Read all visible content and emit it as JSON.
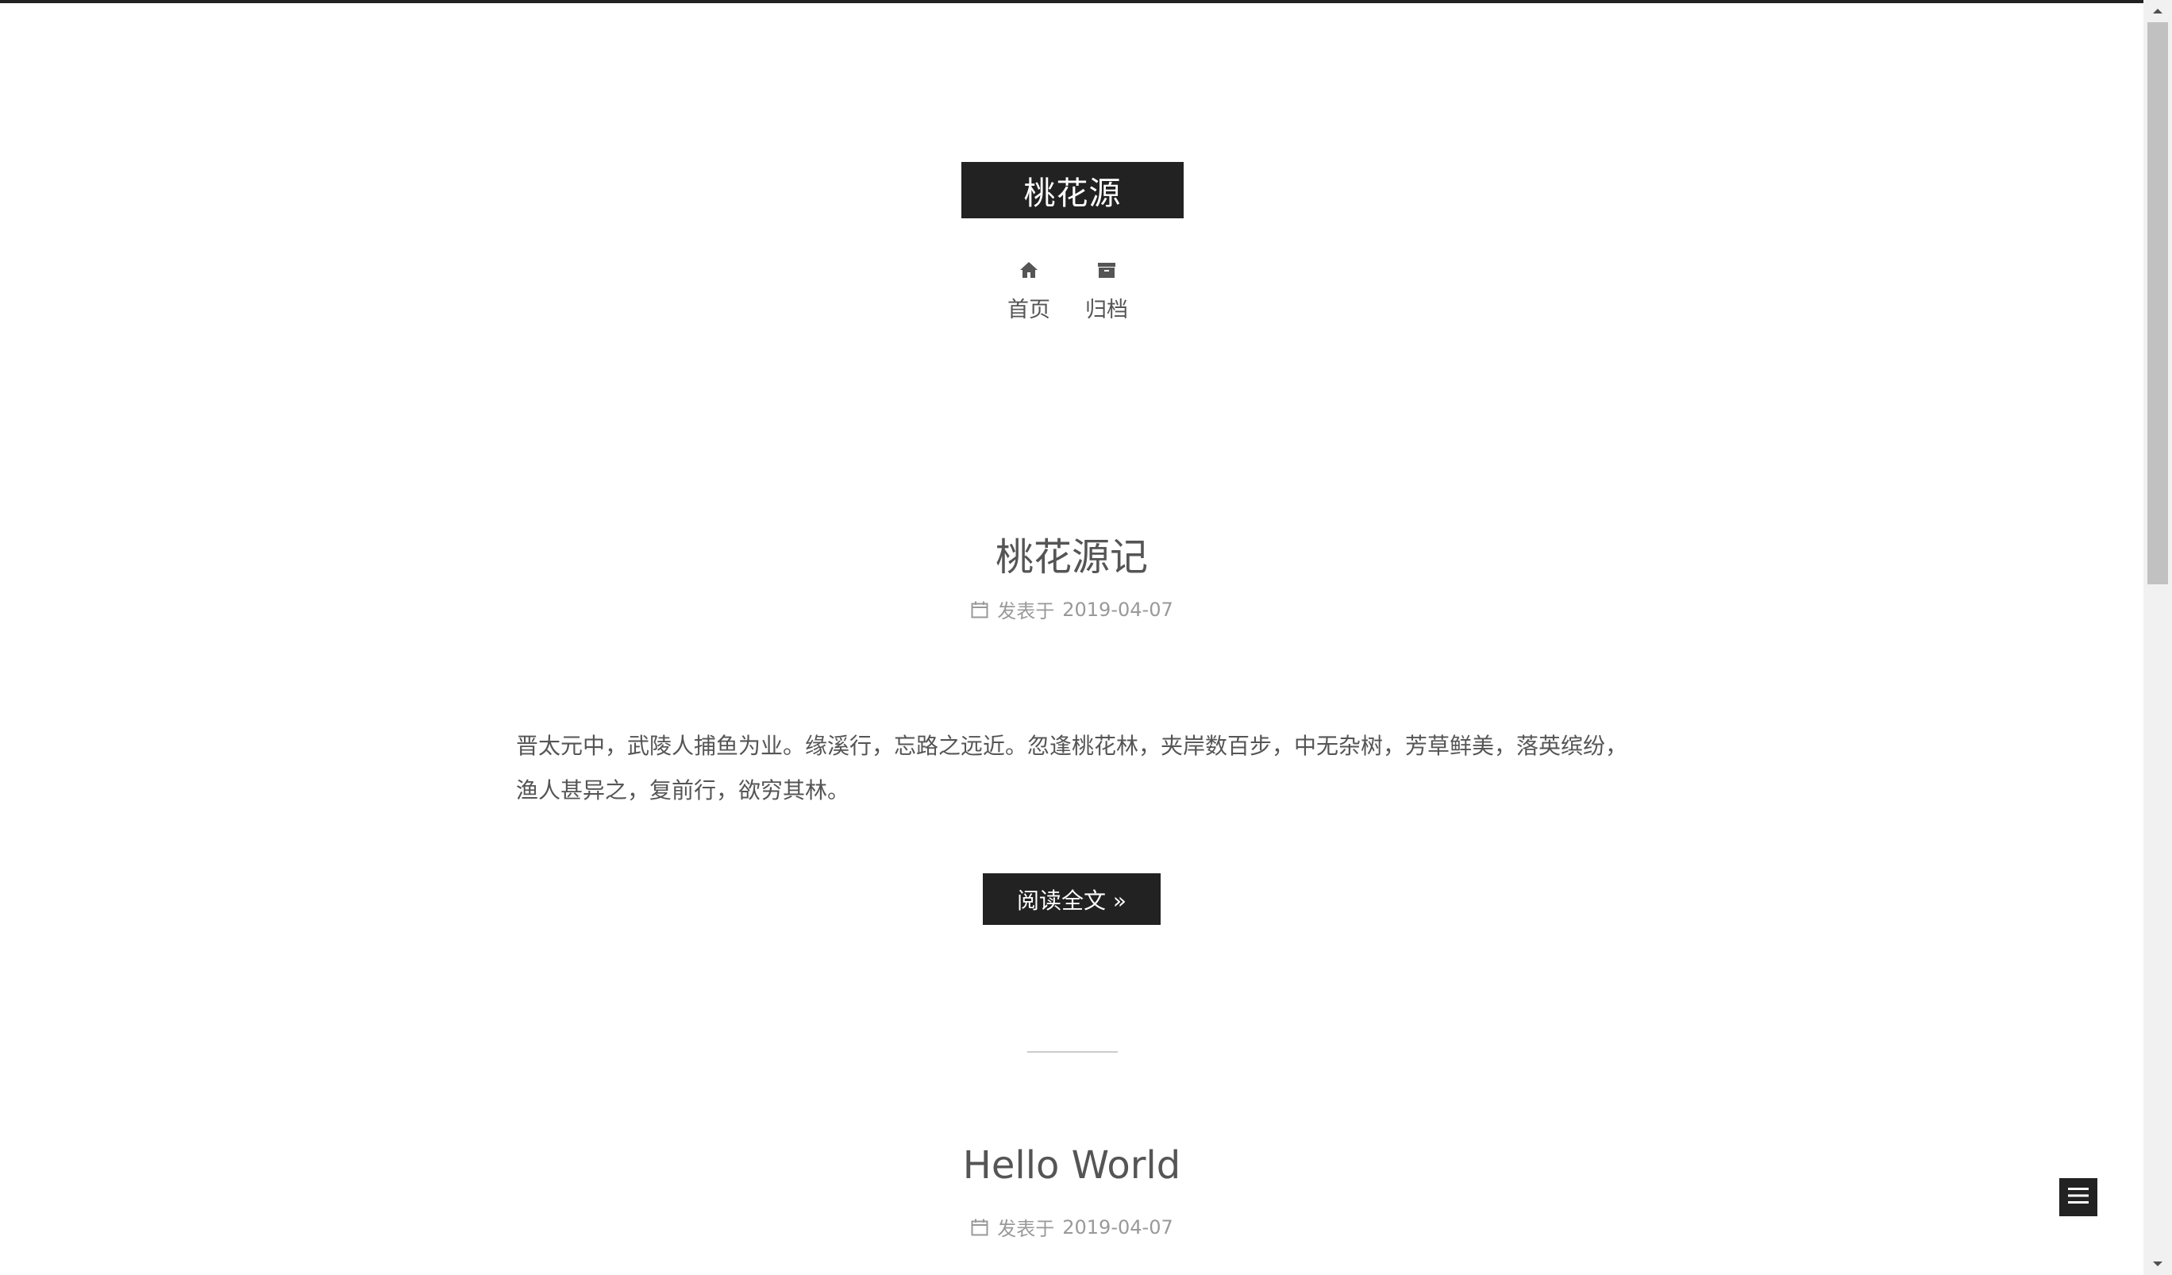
{
  "site": {
    "title": "桃花源"
  },
  "menu": {
    "items": [
      {
        "label": "首页",
        "icon": "home-icon"
      },
      {
        "label": "归档",
        "icon": "archive-icon"
      }
    ]
  },
  "posts": [
    {
      "title": "桃花源记",
      "meta_prefix": "发表于",
      "date": "2019-04-07",
      "excerpt": "晋太元中，武陵人捕鱼为业。缘溪行，忘路之远近。忽逢桃花林，夹岸数百步，中无杂树，芳草鲜美，落英缤纷，渔人甚异之，复前行，欲穷其林。",
      "read_more": "阅读全文 »"
    },
    {
      "title": "Hello World",
      "meta_prefix": "发表于",
      "date": "2019-04-07"
    }
  ],
  "colors": {
    "brand_bg": "#222222",
    "text": "#555555",
    "meta": "#999999"
  },
  "icons": {
    "calendar": "calendar-icon",
    "sidebar_toggle": "menu-icon"
  }
}
